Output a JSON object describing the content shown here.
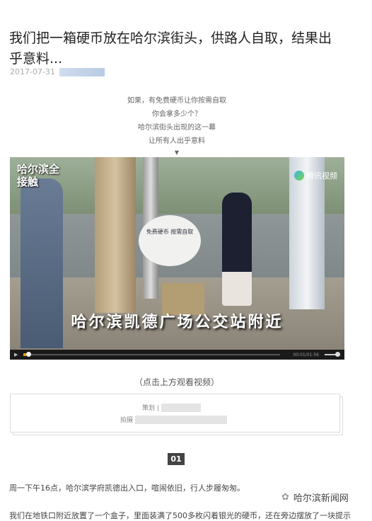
{
  "article": {
    "title": "我们把一箱硬币放在哈尔滨街头，供路人自取，结果出乎意料...",
    "date": "2017-07-31"
  },
  "intro": [
    "如果，有免费硬币让你按需自取",
    "你会拿多少个？",
    "哈尔滨街头出现的这一幕",
    "让所有人出乎意料",
    "▼"
  ],
  "video": {
    "channel_logo": "哈尔滨全接触",
    "platform": "腾讯视频",
    "caption": "哈尔滨凯德广场公交站附近",
    "sign_text": "免费硬币 按需自取",
    "time": "00:01/01:56",
    "progress": 0.01
  },
  "video_hint": "（点击上方观看视频）",
  "credits": {
    "planner_label": "策划 |",
    "photo_label": "拍摄"
  },
  "section_number": "01",
  "paragraphs": [
    "周一下午16点，哈尔滨学府凯德出入口，喧闹依旧，行人步履匆匆。",
    "我们在地铁口附近放置了一个盒子，里面装满了500多枚闪着银光的硬币，还在旁边摆放了一块提示"
  ],
  "watermark": "哈尔滨新闻网"
}
